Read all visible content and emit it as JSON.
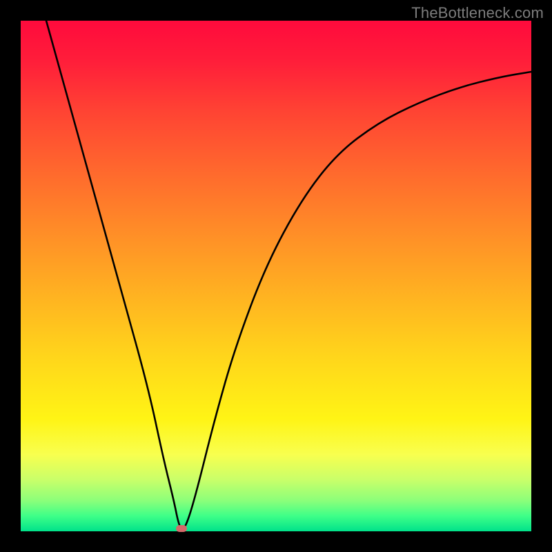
{
  "watermark": "TheBottleneck.com",
  "chart_data": {
    "type": "line",
    "title": "",
    "xlabel": "",
    "ylabel": "",
    "xlim": [
      0,
      100
    ],
    "ylim": [
      0,
      100
    ],
    "grid": false,
    "series": [
      {
        "name": "bottleneck-curve",
        "x": [
          5,
          10,
          15,
          20,
          25,
          28,
          30,
          31,
          32,
          34,
          38,
          42,
          48,
          55,
          62,
          70,
          78,
          86,
          94,
          100
        ],
        "values": [
          100,
          82,
          64,
          46,
          28,
          14,
          6,
          1,
          0,
          6,
          22,
          36,
          52,
          65,
          74,
          80,
          84,
          87,
          89,
          90
        ]
      }
    ],
    "marker": {
      "x": 31.5,
      "y": 0.6
    },
    "background_gradient": {
      "top": "#ff0a3c",
      "mid": "#ffd61b",
      "bottom": "#00e28a"
    }
  }
}
